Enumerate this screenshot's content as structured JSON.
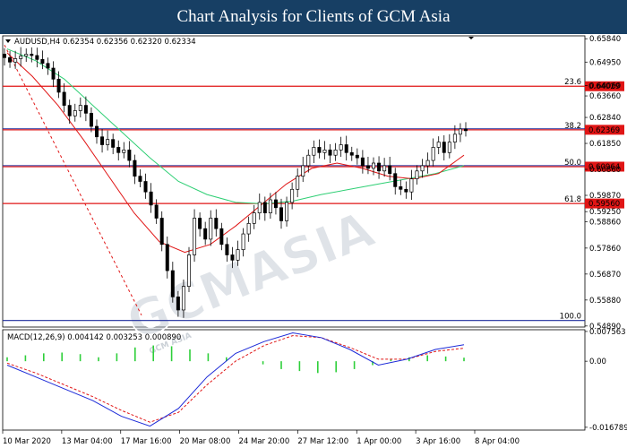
{
  "header": {
    "title": "Chart Analysis for Clients of GCM Asia"
  },
  "symbol_info": "AUDUSD,H4  0.62354 0.62356 0.62320 0.62334",
  "macd_info": "MACD(12,26,9) 0.004142 0.003253 0.000890",
  "watermark": {
    "main": "GCMASIA",
    "sub": "GCM ASIA"
  },
  "chart_data": [
    {
      "type": "candlestick",
      "title": "AUDUSD,H4",
      "ohlc_last": {
        "open": 0.62354,
        "high": 0.62356,
        "low": 0.6232,
        "close": 0.62334
      },
      "ylim": [
        0.5485,
        0.6595
      ],
      "y_ticks": [
        "0.65840",
        "0.64950",
        "0.64060",
        "0.63660",
        "0.62840",
        "0.61850",
        "0.60860",
        "0.59870",
        "0.59250",
        "0.58860",
        "0.57860",
        "0.56870",
        "0.55880",
        "0.54890"
      ],
      "x_ticks": [
        "10 Mar 2020",
        "13 Mar 04:00",
        "17 Mar 16:00",
        "20 Mar 08:00",
        "24 Mar 20:00",
        "27 Mar 12:00",
        "1 Apr 00:00",
        "3 Apr 16:00",
        "8 Apr 04:00"
      ],
      "fibonacci": [
        {
          "level": "23.6",
          "price": 0.64029,
          "price_label": "0.64029"
        },
        {
          "level": "38.2",
          "price": 0.62369,
          "price_label": "0.62369"
        },
        {
          "level": "50.0",
          "price": 0.60964,
          "price_label": "0.60964"
        },
        {
          "level": "61.8",
          "price": 0.5956,
          "price_label": "0.59560"
        },
        {
          "level": "100.0",
          "price": 0.551,
          "price_label": ""
        }
      ],
      "closes": [
        0.6512,
        0.6495,
        0.6508,
        0.6518,
        0.6525,
        0.652,
        0.6505,
        0.649,
        0.6472,
        0.643,
        0.638,
        0.633,
        0.629,
        0.631,
        0.633,
        0.63,
        0.625,
        0.621,
        0.618,
        0.62,
        0.617,
        0.615,
        0.616,
        0.612,
        0.606,
        0.604,
        0.6,
        0.595,
        0.59,
        0.58,
        0.57,
        0.56,
        0.555,
        0.564,
        0.576,
        0.59,
        0.586,
        0.582,
        0.59,
        0.586,
        0.58,
        0.576,
        0.574,
        0.578,
        0.584,
        0.588,
        0.592,
        0.596,
        0.592,
        0.597,
        0.594,
        0.589,
        0.596,
        0.601,
        0.606,
        0.61,
        0.614,
        0.617,
        0.615,
        0.616,
        0.614,
        0.616,
        0.618,
        0.615,
        0.614,
        0.613,
        0.61,
        0.609,
        0.611,
        0.608,
        0.61,
        0.607,
        0.602,
        0.601,
        0.6,
        0.605,
        0.608,
        0.61,
        0.612,
        0.617,
        0.619,
        0.615,
        0.619,
        0.622,
        0.624,
        0.62334
      ],
      "ma_fast": [
        0.653,
        0.644,
        0.633,
        0.62,
        0.606,
        0.592,
        0.581,
        0.577,
        0.58,
        0.587,
        0.595,
        0.603,
        0.609,
        0.611,
        0.609,
        0.606,
        0.605,
        0.607,
        0.614
      ],
      "ma_slow": [
        0.6545,
        0.65,
        0.643,
        0.633,
        0.623,
        0.613,
        0.604,
        0.599,
        0.596,
        0.5955,
        0.5965,
        0.599,
        0.601,
        0.603,
        0.605,
        0.607,
        0.61
      ],
      "trendline": {
        "from": 0.656,
        "to": 0.553
      }
    },
    {
      "type": "line",
      "title": "MACD(12,26,9)",
      "ylim": [
        -0.0175,
        0.008
      ],
      "y_ticks": [
        "0.007563",
        "0.00",
        "-0.016789"
      ],
      "macd": [
        -0.001,
        -0.004,
        -0.007,
        -0.01,
        -0.014,
        -0.0165,
        -0.012,
        -0.004,
        0.002,
        0.005,
        0.0072,
        0.006,
        0.003,
        -0.001,
        0.0005,
        0.003,
        0.0042
      ],
      "signal": [
        -0.0005,
        -0.003,
        -0.006,
        -0.009,
        -0.0125,
        -0.0155,
        -0.013,
        -0.006,
        0.0,
        0.004,
        0.0065,
        0.006,
        0.0035,
        0.0005,
        0.0005,
        0.0025,
        0.0033
      ],
      "histogram": [
        0.001,
        0.0015,
        0.002,
        0.0022,
        0.0018,
        0.001,
        0.002,
        0.0035,
        0.004,
        0.0038,
        0.003,
        0.002,
        0.001,
        0.0,
        -0.0008,
        -0.002,
        -0.0025,
        -0.003,
        -0.0028,
        -0.002,
        -0.001,
        0.0005,
        0.001,
        0.0015,
        0.0012,
        0.0009
      ]
    }
  ]
}
